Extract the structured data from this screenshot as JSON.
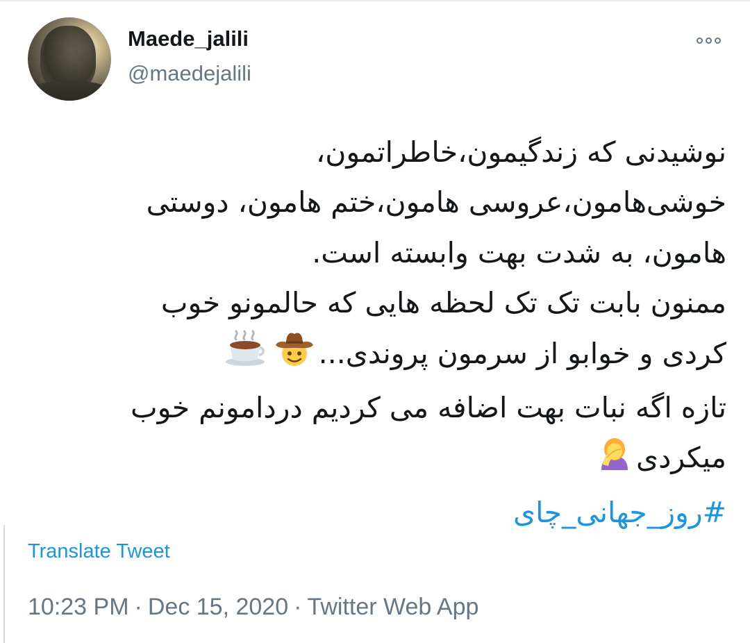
{
  "author": {
    "display_name": "Maede_jalili",
    "handle": "@maedejalili"
  },
  "tweet": {
    "lines": [
      "نوشیدنی که زندگیمون،خاطراتمون،",
      "خوشی‌هامون،عروسی هامون،ختم هامون، دوستی",
      "هامون، به شدت بهت وابسته است.",
      "ممنون بابت تک تک لحظه هایی که حالمونو خوب",
      "کردی و خوابو از سرمون پروندی...",
      "تازه اگه نبات بهت اضافه می کردیم دردامونم خوب",
      "میکردی"
    ],
    "hashtag": "#روز_جهانی_چای",
    "emojis": [
      "cowboy-face-emoji",
      "hot-beverage-emoji",
      "woman-facepalming-emoji"
    ]
  },
  "translate_label": "Translate Tweet",
  "meta": {
    "time": "10:23 PM",
    "separator": "·",
    "date": "Dec 15, 2020",
    "source": "Twitter Web App"
  },
  "colors": {
    "text": "#14171a",
    "secondary": "#657786",
    "link": "#1b95e0",
    "background": "#ffffff"
  }
}
